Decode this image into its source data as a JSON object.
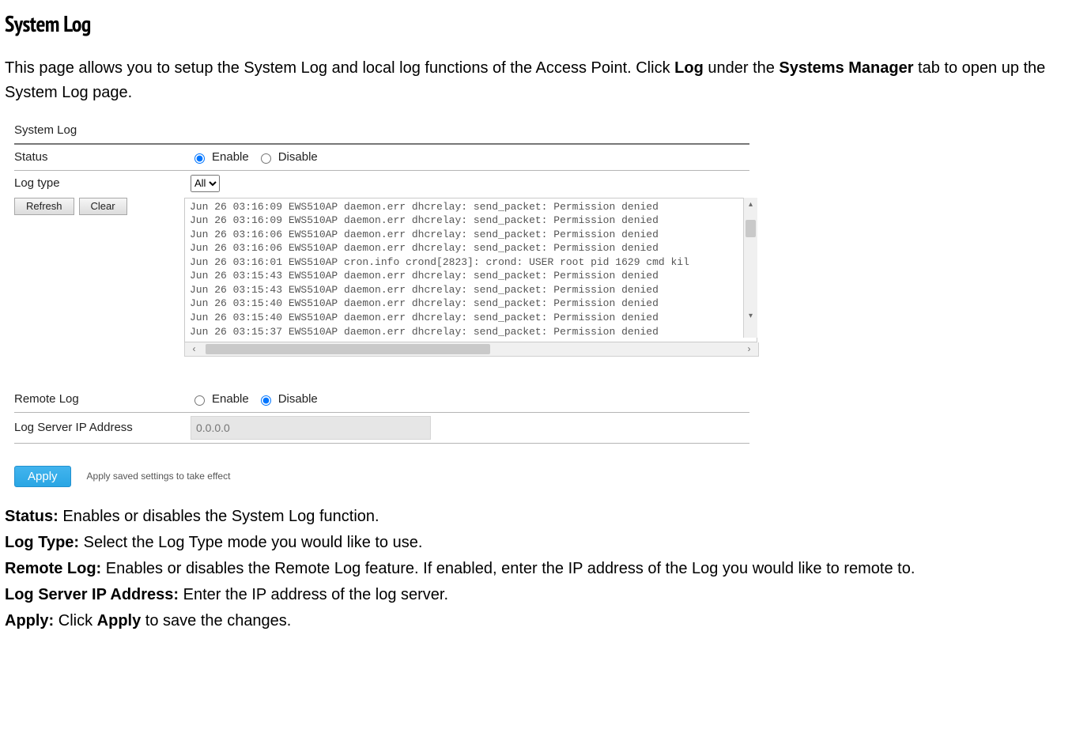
{
  "title": "System Log",
  "intro": {
    "t1": "This page allows you to setup the System Log and local log functions of the Access Point. Click ",
    "b1": "Log",
    "t2": " under the ",
    "b2": "Systems Manager",
    "t3": " tab to open up the System Log page."
  },
  "panel": {
    "section1_title": "System Log",
    "status": {
      "label": "Status",
      "enable": "Enable",
      "disable": "Disable",
      "selected": "enable"
    },
    "logtype": {
      "label": "Log type",
      "value": "All",
      "options": [
        "All"
      ]
    },
    "buttons": {
      "refresh": "Refresh",
      "clear": "Clear"
    },
    "log_lines": [
      "Jun 26 03:16:09 EWS510AP daemon.err dhcrelay: send_packet: Permission denied",
      "Jun 26 03:16:09 EWS510AP daemon.err dhcrelay: send_packet: Permission denied",
      "Jun 26 03:16:06 EWS510AP daemon.err dhcrelay: send_packet: Permission denied",
      "Jun 26 03:16:06 EWS510AP daemon.err dhcrelay: send_packet: Permission denied",
      "Jun 26 03:16:01 EWS510AP cron.info crond[2823]: crond: USER root pid 1629 cmd kil",
      "Jun 26 03:15:43 EWS510AP daemon.err dhcrelay: send_packet: Permission denied",
      "Jun 26 03:15:43 EWS510AP daemon.err dhcrelay: send_packet: Permission denied",
      "Jun 26 03:15:40 EWS510AP daemon.err dhcrelay: send_packet: Permission denied",
      "Jun 26 03:15:40 EWS510AP daemon.err dhcrelay: send_packet: Permission denied",
      "Jun 26 03:15:37 EWS510AP daemon.err dhcrelay: send_packet: Permission denied"
    ],
    "remote": {
      "label": "Remote Log",
      "enable": "Enable",
      "disable": "Disable",
      "selected": "disable"
    },
    "ip": {
      "label": "Log Server IP Address",
      "placeholder": "0.0.0.0"
    },
    "apply": {
      "button": "Apply",
      "note": "Apply saved settings to take effect"
    }
  },
  "descs": {
    "status_l": "Status:",
    "status_t": " Enables or disables the System Log function.",
    "logtype_l": "Log Type:",
    "logtype_t": " Select the Log Type mode you would like to use.",
    "remote_l": "Remote Log:",
    "remote_t": " Enables or disables the Remote Log feature. If enabled, enter the IP address of the Log you would like to remote to.",
    "ip_l": "Log Server IP Address:",
    "ip_t": " Enter the IP address of the log server.",
    "apply_l": "Apply:",
    "apply_t1": " Click ",
    "apply_b": "Apply",
    "apply_t2": " to save the changes."
  }
}
